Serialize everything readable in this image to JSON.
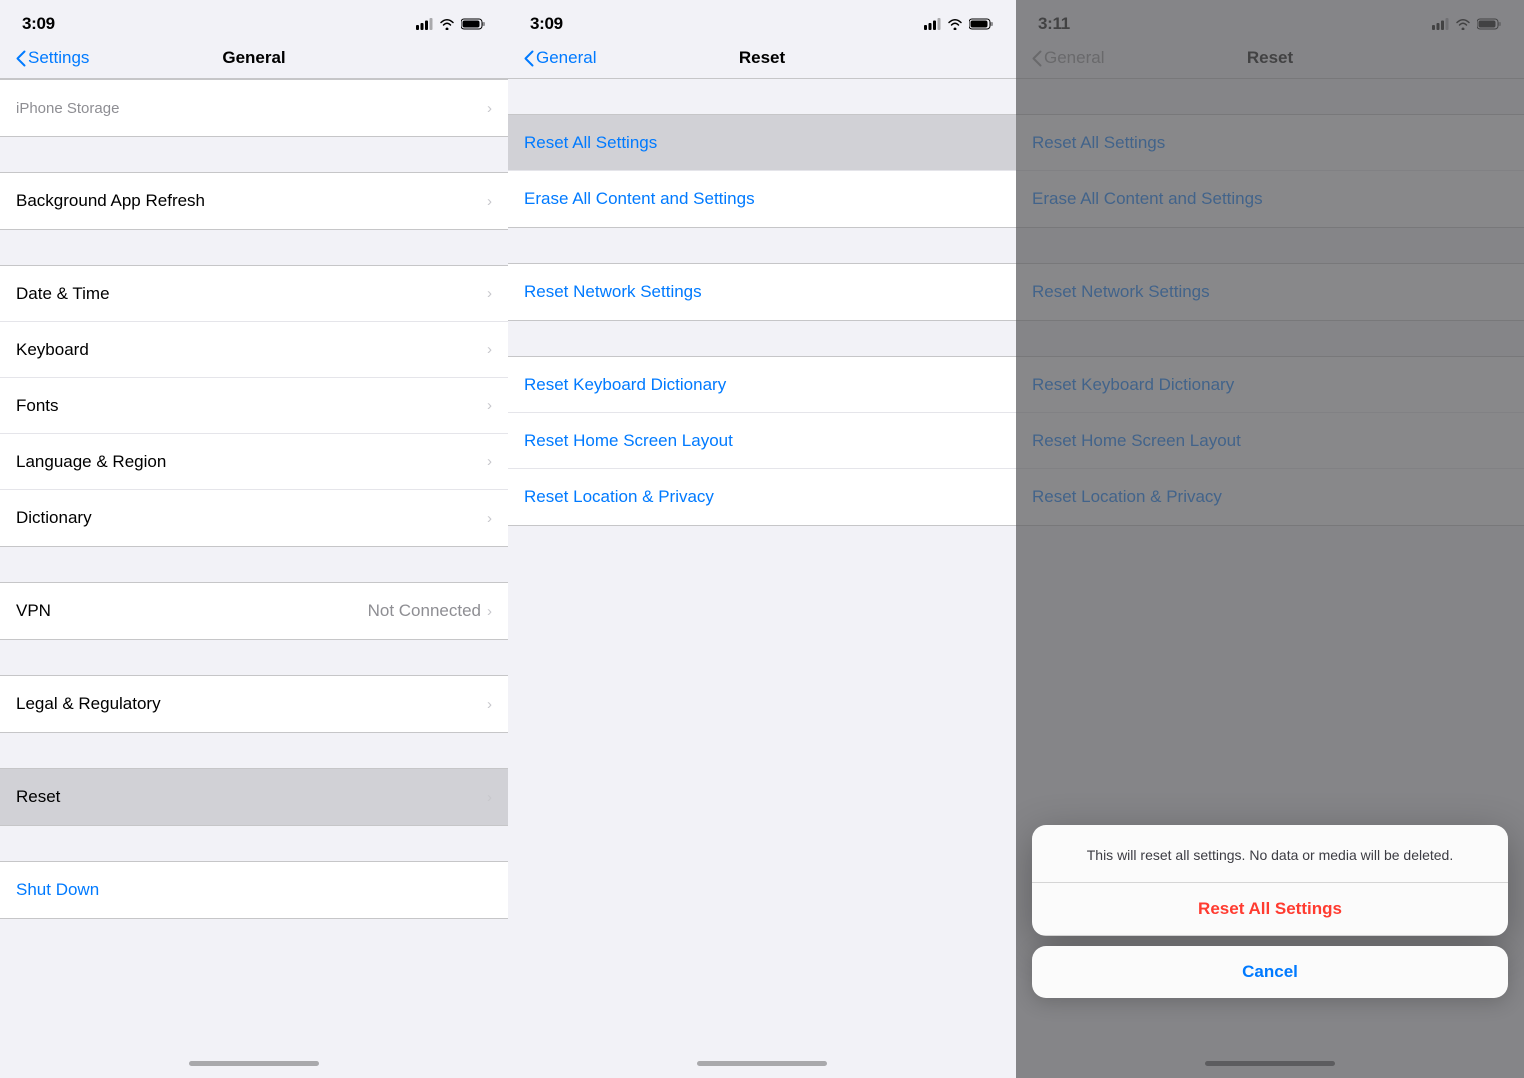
{
  "panel1": {
    "statusBar": {
      "time": "3:09"
    },
    "nav": {
      "backLabel": "Settings",
      "title": "General"
    },
    "rows": [
      {
        "id": "iphone-storage",
        "label": "iPhone Storage",
        "value": "",
        "hasChevron": true,
        "highlighted": false,
        "blue": false
      },
      {
        "id": "background-app-refresh",
        "label": "Background App Refresh",
        "value": "",
        "hasChevron": true,
        "highlighted": false,
        "blue": false
      },
      {
        "id": "date-time",
        "label": "Date & Time",
        "value": "",
        "hasChevron": true,
        "highlighted": false,
        "blue": false
      },
      {
        "id": "keyboard",
        "label": "Keyboard",
        "value": "",
        "hasChevron": true,
        "highlighted": false,
        "blue": false
      },
      {
        "id": "fonts",
        "label": "Fonts",
        "value": "",
        "hasChevron": true,
        "highlighted": false,
        "blue": false
      },
      {
        "id": "language-region",
        "label": "Language & Region",
        "value": "",
        "hasChevron": true,
        "highlighted": false,
        "blue": false
      },
      {
        "id": "dictionary",
        "label": "Dictionary",
        "value": "",
        "hasChevron": true,
        "highlighted": false,
        "blue": false
      },
      {
        "id": "vpn",
        "label": "VPN",
        "value": "Not Connected",
        "hasChevron": true,
        "highlighted": false,
        "blue": false
      },
      {
        "id": "legal",
        "label": "Legal & Regulatory",
        "value": "",
        "hasChevron": true,
        "highlighted": false,
        "blue": false
      },
      {
        "id": "reset",
        "label": "Reset",
        "value": "",
        "hasChevron": true,
        "highlighted": true,
        "blue": false
      },
      {
        "id": "shutdown",
        "label": "Shut Down",
        "value": "",
        "hasChevron": false,
        "highlighted": false,
        "blue": true
      }
    ]
  },
  "panel2": {
    "statusBar": {
      "time": "3:09"
    },
    "nav": {
      "backLabel": "General",
      "title": "Reset"
    },
    "rows": [
      {
        "id": "reset-all-settings",
        "label": "Reset All Settings",
        "highlighted": true,
        "blue": true
      },
      {
        "id": "erase-all",
        "label": "Erase All Content and Settings",
        "highlighted": false,
        "blue": true
      },
      {
        "id": "reset-network",
        "label": "Reset Network Settings",
        "highlighted": false,
        "blue": true
      },
      {
        "id": "reset-keyboard",
        "label": "Reset Keyboard Dictionary",
        "highlighted": false,
        "blue": true
      },
      {
        "id": "reset-home",
        "label": "Reset Home Screen Layout",
        "highlighted": false,
        "blue": true
      },
      {
        "id": "reset-location",
        "label": "Reset Location & Privacy",
        "highlighted": false,
        "blue": true
      }
    ]
  },
  "panel3": {
    "statusBar": {
      "time": "3:11"
    },
    "nav": {
      "backLabel": "General",
      "title": "Reset"
    },
    "rows": [
      {
        "id": "reset-all-settings",
        "label": "Reset All Settings",
        "blue": true
      },
      {
        "id": "erase-all",
        "label": "Erase All Content and Settings",
        "blue": true
      },
      {
        "id": "reset-network",
        "label": "Reset Network Settings",
        "blue": true
      },
      {
        "id": "reset-keyboard",
        "label": "Reset Keyboard Dictionary",
        "blue": true
      },
      {
        "id": "reset-home",
        "label": "Reset Home Screen Layout",
        "blue": true
      },
      {
        "id": "reset-location",
        "label": "Reset Location & Privacy",
        "blue": true
      }
    ],
    "dialog": {
      "message": "This will reset all settings. No data or media will be deleted.",
      "actionLabel": "Reset All Settings",
      "cancelLabel": "Cancel"
    }
  }
}
